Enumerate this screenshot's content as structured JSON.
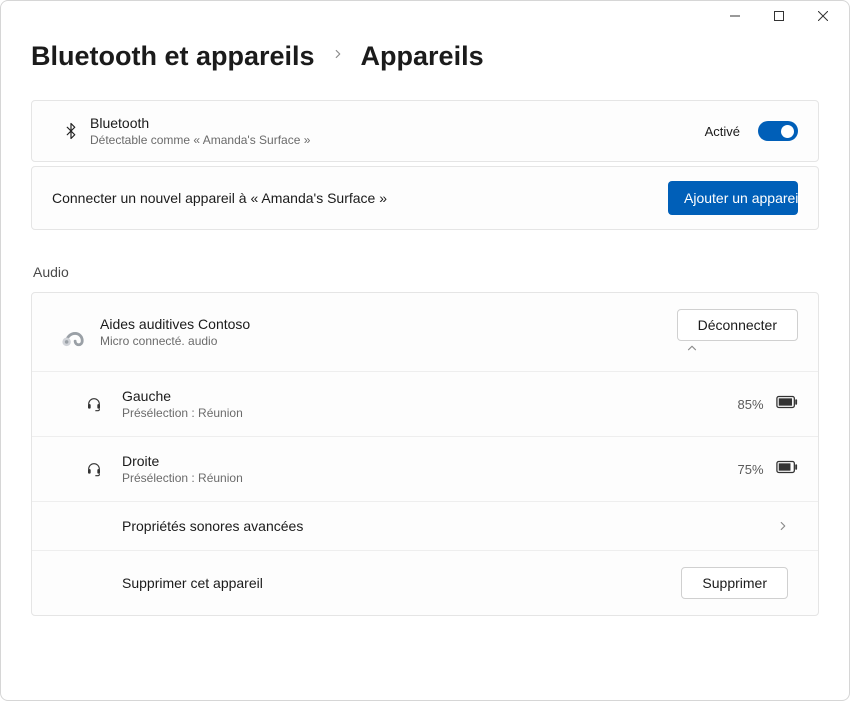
{
  "breadcrumb": {
    "parent": "Bluetooth et appareils",
    "current": "Appareils"
  },
  "bluetooth": {
    "title": "Bluetooth",
    "subtitle": "Détectable comme « Amanda's Surface »",
    "toggle_label": "Activé"
  },
  "connect": {
    "prompt": "Connecter un nouvel appareil à « Amanda's Surface »",
    "button": "Ajouter un appareil"
  },
  "audio_section": "Audio",
  "device": {
    "name": "Aides auditives Contoso",
    "status": "Micro connecté. audio",
    "disconnect": "Déconnecter",
    "left": {
      "label": "Gauche",
      "preset": "Présélection : Réunion",
      "battery": "85%"
    },
    "right": {
      "label": "Droite",
      "preset": "Présélection : Réunion",
      "battery": "75%"
    },
    "advanced": "Propriétés sonores avancées",
    "remove_label": "Supprimer cet appareil",
    "remove_button": "Supprimer"
  }
}
